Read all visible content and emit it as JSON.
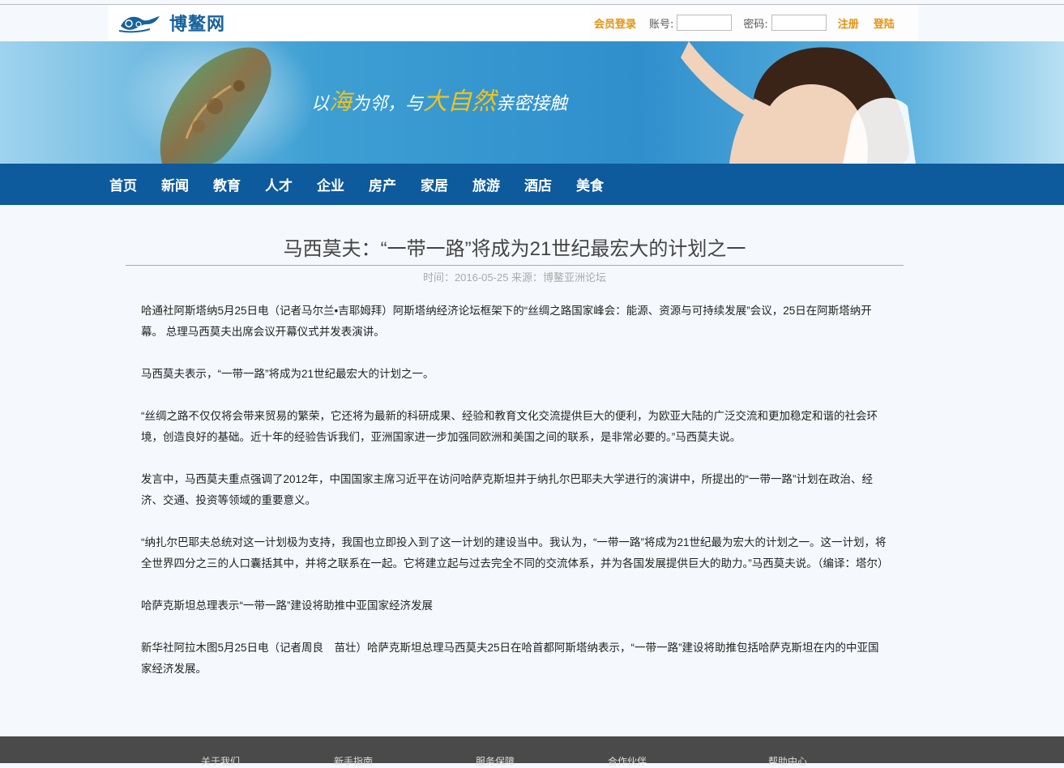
{
  "header": {
    "logo_text": "博鳌网",
    "member_login": "会员登录",
    "account_label": "账号:",
    "password_label": "密码:",
    "register": "注册",
    "signin": "登陆"
  },
  "banner": {
    "slogan": "以海为邻，与大自然亲密接触"
  },
  "nav": {
    "items": [
      "首页",
      "新闻",
      "教育",
      "人才",
      "企业",
      "房产",
      "家居",
      "旅游",
      "酒店",
      "美食"
    ]
  },
  "article": {
    "title": "马西莫夫：“一带一路”将成为21世纪最宏大的计划之一",
    "meta": "时间：2016-05-25 来源：博鳌亚洲论坛",
    "paragraphs": [
      "哈通社阿斯塔纳5月25日电（记者马尔兰•吉耶姆拜）阿斯塔纳经济论坛框架下的“丝绸之路国家峰会：能源、资源与可持续发展”会议，25日在阿斯塔纳开幕。 总理马西莫夫出席会议开幕仪式并发表演讲。",
      "马西莫夫表示，“一带一路”将成为21世纪最宏大的计划之一。",
      "“丝绸之路不仅仅将会带来贸易的繁荣，它还将为最新的科研成果、经验和教育文化交流提供巨大的便利，为欧亚大陆的广泛交流和更加稳定和谐的社会环境，创造良好的基础。近十年的经验告诉我们，亚洲国家进一步加强同欧洲和美国之间的联系，是非常必要的。”马西莫夫说。",
      "发言中，马西莫夫重点强调了2012年，中国国家主席习近平在访问哈萨克斯坦并于纳扎尔巴耶夫大学进行的演讲中，所提出的“一带一路”计划在政治、经济、交通、投资等领域的重要意义。",
      "“纳扎尔巴耶夫总统对这一计划极为支持，我国也立即投入到了这一计划的建设当中。我认为，“一带一路”将成为21世纪最为宏大的计划之一。这一计划，将全世界四分之三的人口囊括其中，并将之联系在一起。它将建立起与过去完全不同的交流体系，并为各国发展提供巨大的助力。”马西莫夫说。（编译：塔尔）",
      "哈萨克斯坦总理表示“一带一路”建设将助推中亚国家经济发展",
      "新华社阿拉木图5月25日电（记者周良　苗壮）哈萨克斯坦总理马西莫夫25日在哈首都阿斯塔纳表示，“一带一路”建设将助推包括哈萨克斯坦在内的中亚国家经济发展。"
    ]
  },
  "footer": {
    "links": [
      "关于我们",
      "新手指南",
      "服务保障",
      "合作伙伴",
      "帮助中心"
    ]
  },
  "colors": {
    "nav_bg": "#0d5a9c",
    "accent": "#e6920d",
    "logo": "#17639c",
    "footer_bg": "#4a4a4a"
  }
}
